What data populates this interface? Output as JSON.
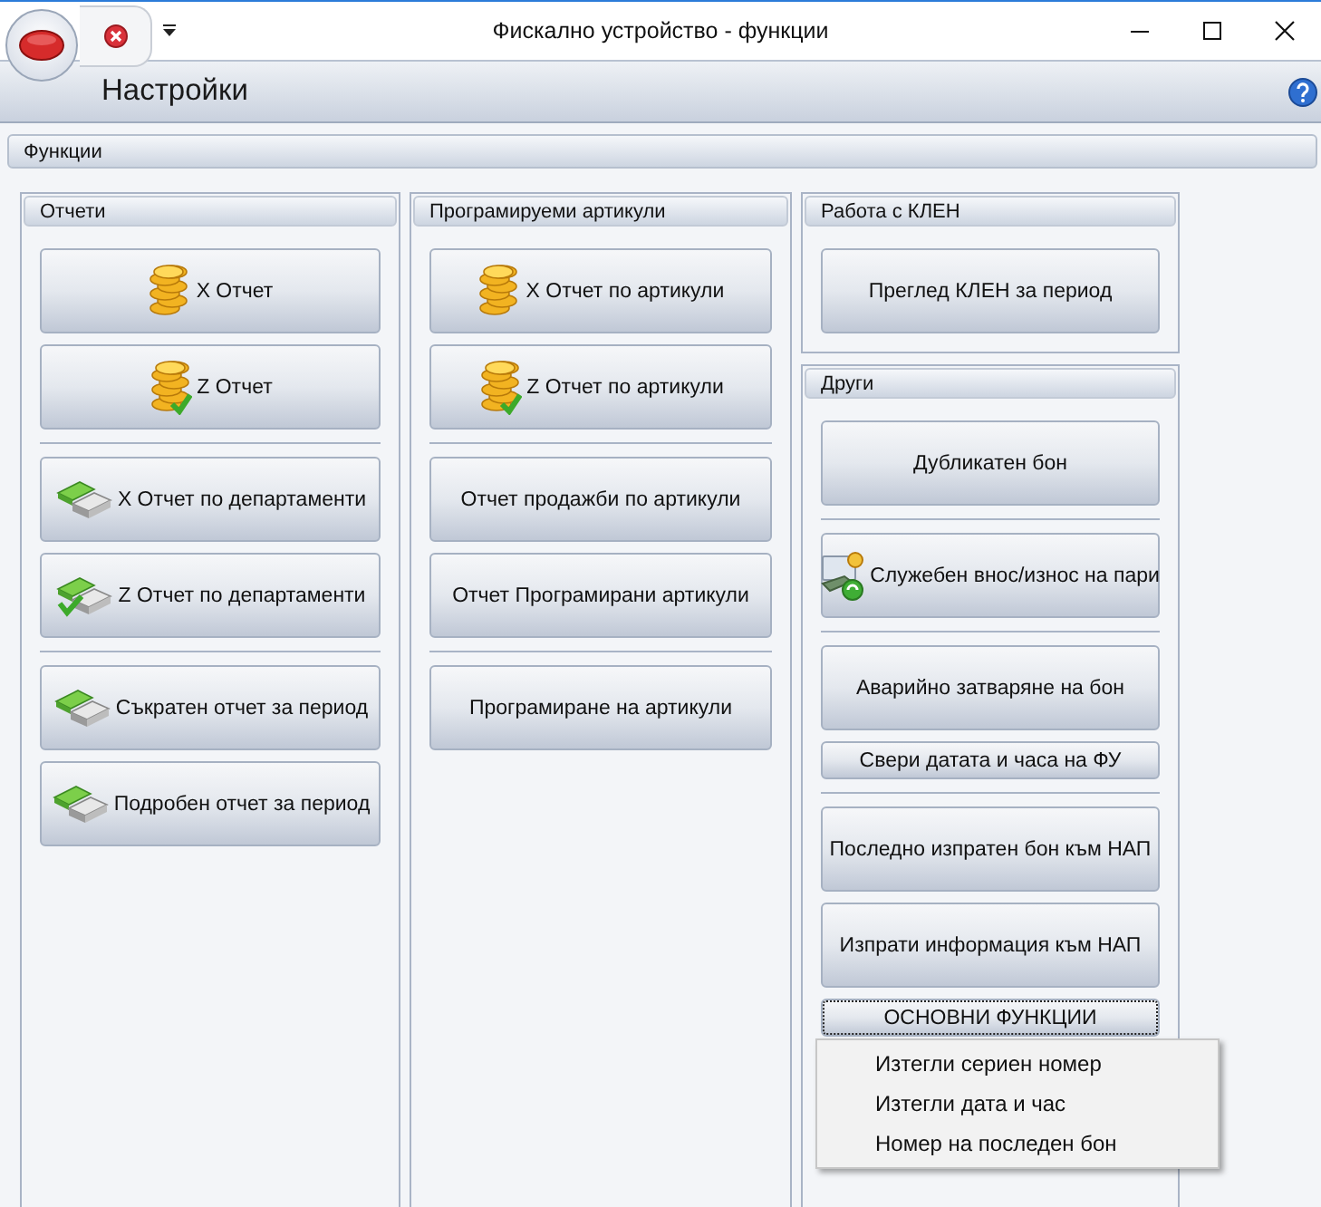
{
  "window": {
    "title": "Фискално устройство - функции"
  },
  "ribbon": {
    "title": "Настройки"
  },
  "panel": {
    "title": "Функции"
  },
  "columns": [
    {
      "groups": [
        {
          "title": "Отчети",
          "sections": [
            [
              {
                "label": "X Отчет",
                "kind": "coins"
              },
              {
                "label": "Z Отчет",
                "kind": "coins-check"
              }
            ],
            [
              {
                "label": "X Отчет по департаменти",
                "kind": "cash"
              },
              {
                "label": "Z Отчет по департаменти",
                "kind": "cash-check"
              }
            ],
            [
              {
                "label": "Съкратен отчет за период",
                "kind": "cash"
              },
              {
                "label": "Подробен отчет за период",
                "kind": "cash"
              }
            ]
          ]
        }
      ]
    },
    {
      "groups": [
        {
          "title": "Програмируеми артикули",
          "sections": [
            [
              {
                "label": "X Отчет по артикули",
                "kind": "coins"
              },
              {
                "label": "Z Отчет по артикули",
                "kind": "coins-check"
              }
            ],
            [
              {
                "label": "Отчет продажби по артикули",
                "kind": "plain"
              },
              {
                "label": "Отчет Програмирани артикули",
                "kind": "plain"
              }
            ],
            [
              {
                "label": "Програмиране на артикули",
                "kind": "plain"
              }
            ]
          ]
        }
      ]
    },
    {
      "groups": [
        {
          "title": "Работа с КЛЕН",
          "sections": [
            [
              {
                "label": "Преглед КЛЕН за период",
                "kind": "plain"
              }
            ]
          ]
        },
        {
          "title": "Други",
          "sections": [
            [
              {
                "label": "Дубликатен бон",
                "kind": "plain"
              }
            ],
            [
              {
                "label": "Служебен внос/износ на пари",
                "kind": "money"
              }
            ],
            [
              {
                "label": "Аварийно затваряне на бон",
                "kind": "plain"
              },
              {
                "label": "Свери датата и часа на ФУ",
                "kind": "compact"
              }
            ],
            [
              {
                "label": "Последно изпратен бон към НАП",
                "kind": "plain"
              },
              {
                "label": "Изпрати информация към НАП",
                "kind": "plain"
              },
              {
                "label": "ОСНОВНИ ФУНКЦИИ",
                "kind": "compact",
                "focused": true
              }
            ]
          ]
        }
      ]
    }
  ],
  "menu": {
    "items": [
      "Изтегли сериен номер",
      "Изтегли дата и час",
      "Номер на последен бон"
    ]
  }
}
